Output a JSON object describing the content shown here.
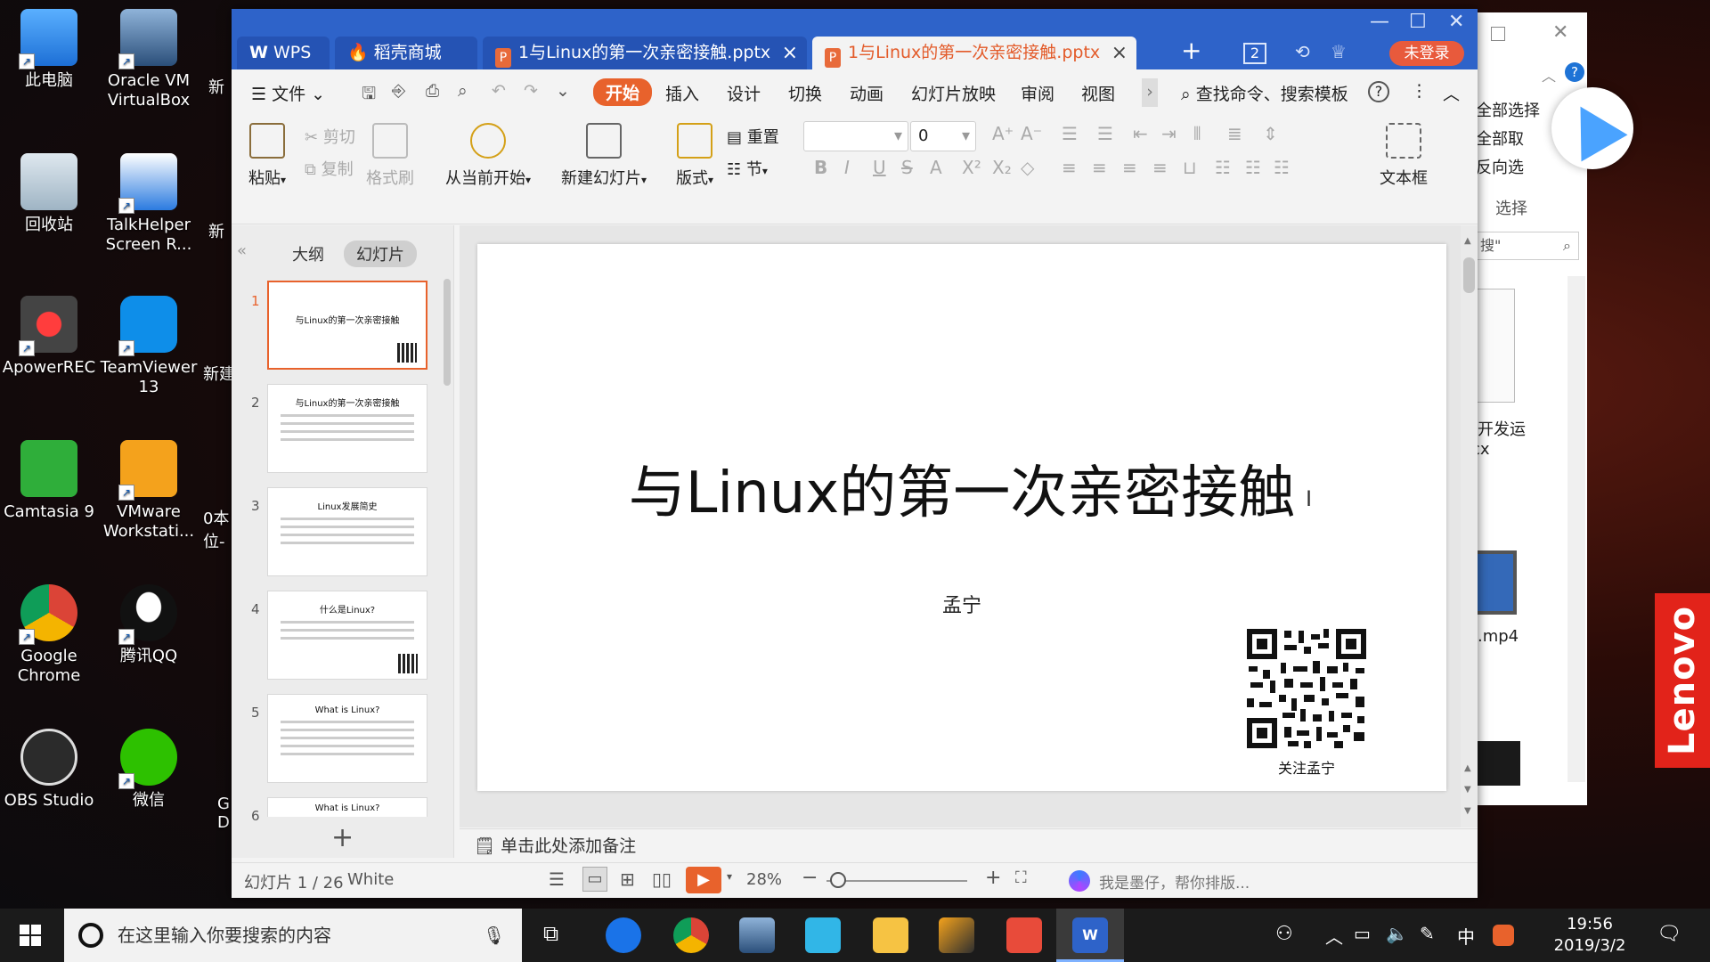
{
  "desktop": {
    "icons": [
      {
        "label": "此电脑"
      },
      {
        "label": "Oracle VM VirtualBox"
      },
      {
        "label": "回收站"
      },
      {
        "label": "TalkHelper Screen R..."
      },
      {
        "label": "ApowerREC"
      },
      {
        "label": "TeamViewer 13"
      },
      {
        "label": "Camtasia 9"
      },
      {
        "label": "VMware Workstati..."
      },
      {
        "label": "Google Chrome"
      },
      {
        "label": "腾讯QQ"
      },
      {
        "label": "OBS Studio"
      },
      {
        "label": "微信"
      }
    ],
    "cut_labels": [
      "新",
      "新",
      "新建",
      "0本 位-",
      "G D"
    ]
  },
  "background_window": {
    "items": [
      "全部选择",
      "全部取",
      "反向选",
      "选择"
    ],
    "search_placeholder": "搜\"",
    "file1": "出开发运\nocx",
    "file2": "机.mp4",
    "help_icon": "?"
  },
  "lenovo_label": "Lenovo",
  "wps": {
    "tabs": [
      {
        "label": "WPS"
      },
      {
        "label": "稻壳商城"
      },
      {
        "label": "1与Linux的第一次亲密接触.pptx"
      },
      {
        "label": "1与Linux的第一次亲密接触.pptx"
      }
    ],
    "tab_count": "2",
    "login_label": "未登录",
    "menu": {
      "file": "文件",
      "items": [
        "开始",
        "插入",
        "设计",
        "切换",
        "动画",
        "幻灯片放映",
        "审阅",
        "视图"
      ],
      "search": "查找命令、搜索模板"
    },
    "ribbon": {
      "paste": "粘贴",
      "cut": "剪切",
      "copy": "复制",
      "format_painter": "格式刷",
      "from_current": "从当前开始",
      "new_slide": "新建幻灯片",
      "layout": "版式",
      "reset": "重置",
      "section": "节",
      "font_size": "0",
      "textbox": "文本框"
    },
    "pane": {
      "outline": "大纲",
      "slides": "幻灯片",
      "thumbs": [
        {
          "num": "1",
          "title": "与Linux的第一次亲密接触"
        },
        {
          "num": "2",
          "title": "与Linux的第一次亲密接触"
        },
        {
          "num": "3",
          "title": "Linux发展简史"
        },
        {
          "num": "4",
          "title": "什么是Linux?"
        },
        {
          "num": "5",
          "title": "What is Linux?"
        },
        {
          "num": "6",
          "title": "What is Linux?"
        }
      ]
    },
    "slide": {
      "title": "与Linux的第一次亲密接触",
      "subtitle": "孟宁",
      "qr_caption": "关注孟宁"
    },
    "notes_placeholder": "单击此处添加备注",
    "status": {
      "slide_counter": "幻灯片 1 / 26",
      "theme": "White",
      "zoom": "28%",
      "assistant": "我是墨仔，帮你排版..."
    }
  },
  "taskbar": {
    "search_placeholder": "在这里输入你要搜索的内容",
    "ime": "中",
    "time": "19:56",
    "date": "2019/3/2"
  }
}
